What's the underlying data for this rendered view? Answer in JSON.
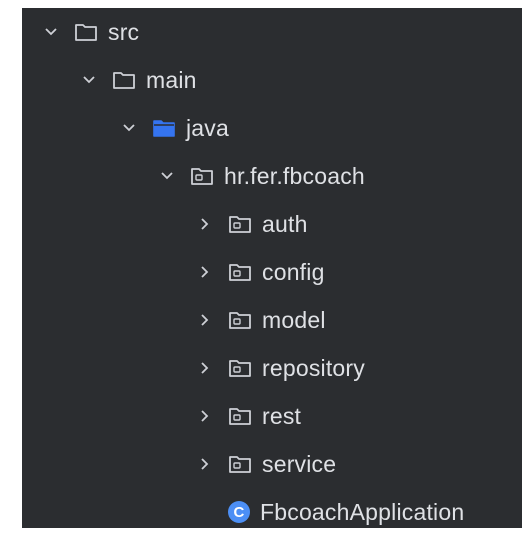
{
  "tree": {
    "items": [
      {
        "label": "src",
        "expanded": true,
        "depth": 0,
        "icon": "folder-icon"
      },
      {
        "label": "main",
        "expanded": true,
        "depth": 1,
        "icon": "folder-icon"
      },
      {
        "label": "java",
        "expanded": true,
        "depth": 2,
        "icon": "source-root-folder-icon"
      },
      {
        "label": "hr.fer.fbcoach",
        "expanded": true,
        "depth": 3,
        "icon": "package-icon"
      },
      {
        "label": "auth",
        "expanded": false,
        "depth": 4,
        "icon": "package-icon"
      },
      {
        "label": "config",
        "expanded": false,
        "depth": 4,
        "icon": "package-icon"
      },
      {
        "label": "model",
        "expanded": false,
        "depth": 4,
        "icon": "package-icon"
      },
      {
        "label": "repository",
        "expanded": false,
        "depth": 4,
        "icon": "package-icon"
      },
      {
        "label": "rest",
        "expanded": false,
        "depth": 4,
        "icon": "package-icon"
      },
      {
        "label": "service",
        "expanded": false,
        "depth": 4,
        "icon": "package-icon"
      },
      {
        "label": "FbcoachApplication",
        "depth": 4,
        "icon": "java-class-icon",
        "class_letter": "C"
      }
    ]
  },
  "colors": {
    "background": "#2b2d30",
    "text": "#dfe1e5",
    "icon_outline": "#ced0d6",
    "source_root": "#3574f0",
    "class_badge": "#4c8ff5"
  }
}
